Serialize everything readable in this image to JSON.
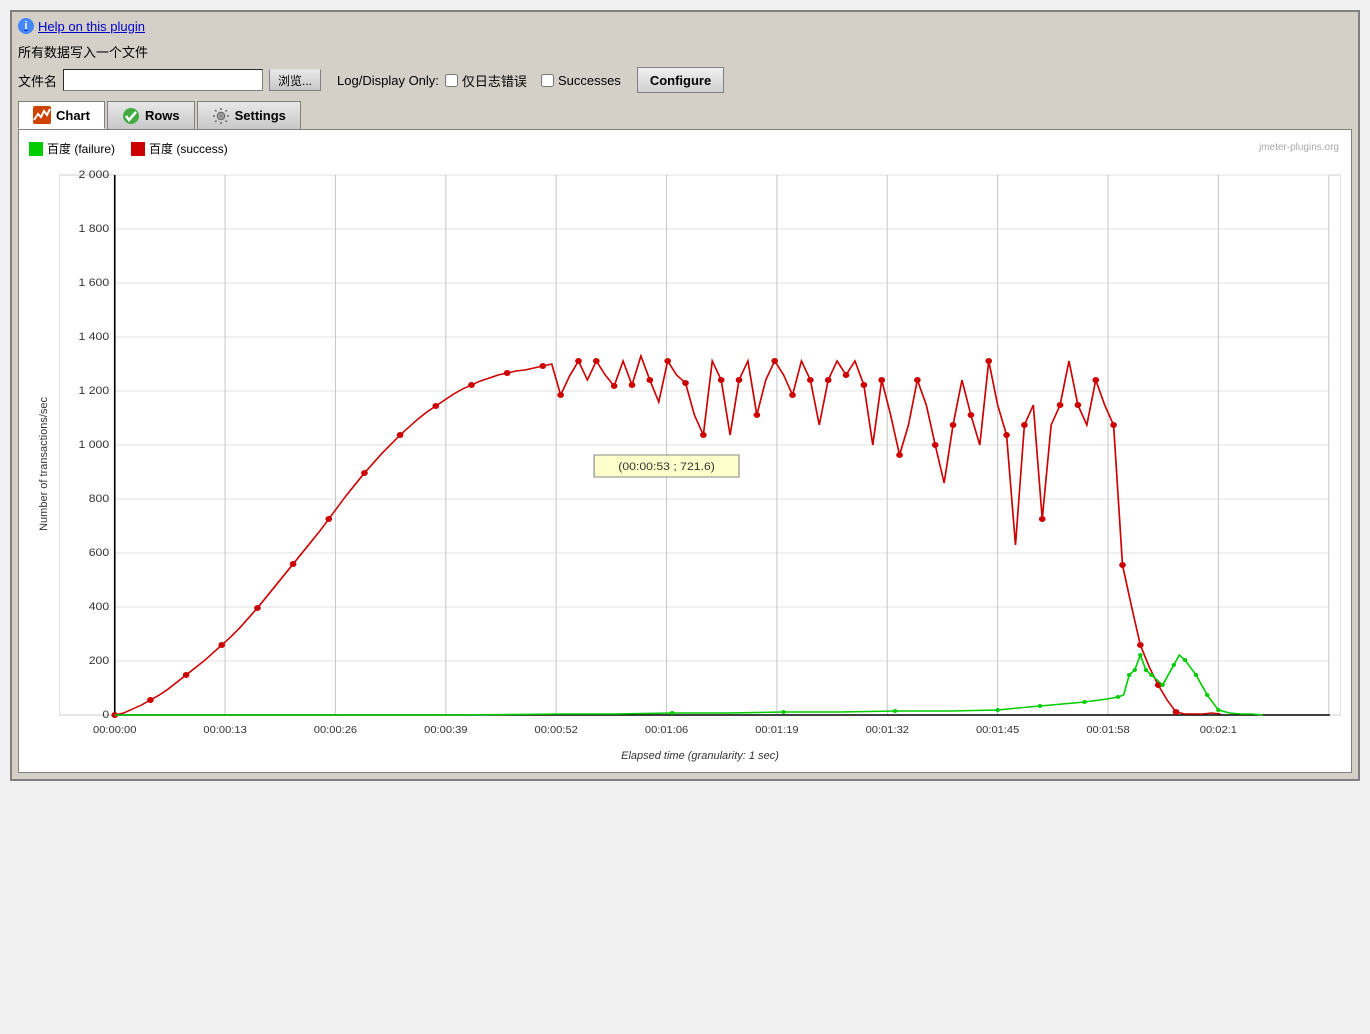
{
  "help": {
    "link_text": "Help on this plugin",
    "icon": "i"
  },
  "file_section": {
    "title": "所有数据写入一个文件",
    "file_label": "文件名",
    "browse_button": "浏览...",
    "log_display_label": "Log/Display Only:",
    "checkbox_errors_label": "仅日志错误",
    "checkbox_success_label": "Successes",
    "configure_button": "Configure"
  },
  "tabs": [
    {
      "id": "chart",
      "label": "Chart",
      "active": true
    },
    {
      "id": "rows",
      "label": "Rows",
      "active": false
    },
    {
      "id": "settings",
      "label": "Settings",
      "active": false
    }
  ],
  "chart": {
    "watermark": "jmeter-plugins.org",
    "legend": [
      {
        "id": "failure",
        "label": "百度 (failure)",
        "color": "#00cc00"
      },
      {
        "id": "success",
        "label": "百度 (success)",
        "color": "#cc0000"
      }
    ],
    "y_axis_label": "Number of transactions/sec",
    "x_axis_label": "Elapsed time (granularity: 1 sec)",
    "y_ticks": [
      "0",
      "200",
      "400",
      "600",
      "800",
      "1 000",
      "1 200",
      "1 400",
      "1 600",
      "1 800",
      "2 000"
    ],
    "x_ticks": [
      "00:00:00",
      "00:00:13",
      "00:00:26",
      "00:00:39",
      "00:00:52",
      "00:01:06",
      "00:01:19",
      "00:01:32",
      "00:01:45",
      "00:01:58",
      "00:02:1"
    ],
    "tooltip": "(00:00:53 ; 721.6)"
  }
}
